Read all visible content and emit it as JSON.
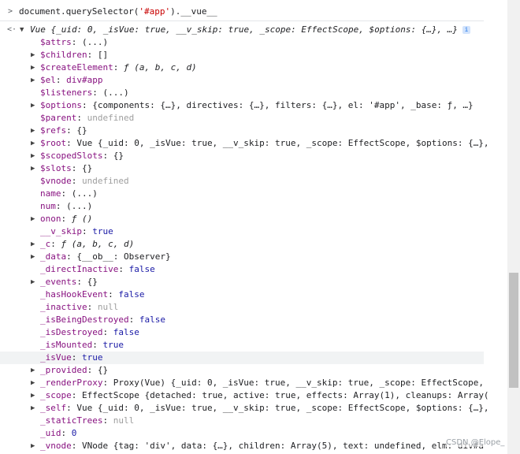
{
  "console": {
    "input": {
      "prefix": "document.querySelector(",
      "arg": "'#app'",
      "suffix": ").__vue__"
    },
    "result_summary": "Vue {_uid: 0, _isVue: true, __v_skip: true, _scope: EffectScope, $options: {…}, …}",
    "info_badge": "i",
    "properties": [
      {
        "key": "$attrs",
        "sep": ": ",
        "value": "(...)",
        "expandable": false,
        "dim": false
      },
      {
        "key": "$children",
        "sep": ": ",
        "value": "[]",
        "expandable": true,
        "dim": false
      },
      {
        "key": "$createElement",
        "sep": ": ",
        "value": "ƒ (a, b, c, d)",
        "expandable": true,
        "dim": false
      },
      {
        "key": "$el",
        "sep": ": ",
        "value": "div#app",
        "expandable": true,
        "dim": false
      },
      {
        "key": "$listeners",
        "sep": ": ",
        "value": "(...)",
        "expandable": false,
        "dim": false
      },
      {
        "key": "$options",
        "sep": ": ",
        "value": "{components: {…}, directives: {…}, filters: {…}, el: '#app', _base: ƒ, …}",
        "expandable": true,
        "dim": false
      },
      {
        "key": "$parent",
        "sep": ": ",
        "value": "undefined",
        "expandable": false,
        "dim": false
      },
      {
        "key": "$refs",
        "sep": ": ",
        "value": "{}",
        "expandable": true,
        "dim": false
      },
      {
        "key": "$root",
        "sep": ": ",
        "value": "Vue {_uid: 0, _isVue: true, __v_skip: true, _scope: EffectScope, $options: {…},",
        "expandable": true,
        "dim": false
      },
      {
        "key": "$scopedSlots",
        "sep": ": ",
        "value": "{}",
        "expandable": true,
        "dim": false
      },
      {
        "key": "$slots",
        "sep": ": ",
        "value": "{}",
        "expandable": true,
        "dim": false
      },
      {
        "key": "$vnode",
        "sep": ": ",
        "value": "undefined",
        "expandable": false,
        "dim": false
      },
      {
        "key": "name",
        "sep": ": ",
        "value": "(...)",
        "expandable": false,
        "dim": false
      },
      {
        "key": "num",
        "sep": ": ",
        "value": "(...)",
        "expandable": false,
        "dim": false
      },
      {
        "key": "onon",
        "sep": ": ",
        "value": "ƒ ()",
        "expandable": true,
        "dim": false
      },
      {
        "key": "__v_skip",
        "sep": ": ",
        "value": "true",
        "expandable": false,
        "dim": false
      },
      {
        "key": "_c",
        "sep": ": ",
        "value": "ƒ (a, b, c, d)",
        "expandable": true,
        "dim": false
      },
      {
        "key": "_data",
        "sep": ": ",
        "value": "{__ob__: Observer}",
        "expandable": true,
        "dim": false
      },
      {
        "key": "_directInactive",
        "sep": ": ",
        "value": "false",
        "expandable": false,
        "dim": false
      },
      {
        "key": "_events",
        "sep": ": ",
        "value": "{}",
        "expandable": true,
        "dim": false
      },
      {
        "key": "_hasHookEvent",
        "sep": ": ",
        "value": "false",
        "expandable": false,
        "dim": false
      },
      {
        "key": "_inactive",
        "sep": ": ",
        "value": "null",
        "expandable": false,
        "dim": false
      },
      {
        "key": "_isBeingDestroyed",
        "sep": ": ",
        "value": "false",
        "expandable": false,
        "dim": false
      },
      {
        "key": "_isDestroyed",
        "sep": ": ",
        "value": "false",
        "expandable": false,
        "dim": false
      },
      {
        "key": "_isMounted",
        "sep": ": ",
        "value": "true",
        "expandable": false,
        "dim": false
      },
      {
        "key": "_isVue",
        "sep": ": ",
        "value": "true",
        "expandable": false,
        "dim": false,
        "highlight": true
      },
      {
        "key": "_provided",
        "sep": ": ",
        "value": "{}",
        "expandable": true,
        "dim": false
      },
      {
        "key": "_renderProxy",
        "sep": ": ",
        "value": "Proxy(Vue) {_uid: 0, _isVue: true, __v_skip: true, _scope: EffectScope,",
        "expandable": true,
        "dim": false
      },
      {
        "key": "_scope",
        "sep": ": ",
        "value": "EffectScope {detached: true, active: true, effects: Array(1), cleanups: Array(",
        "expandable": true,
        "dim": false
      },
      {
        "key": "_self",
        "sep": ": ",
        "value": "Vue {_uid: 0, _isVue: true, __v_skip: true, _scope: EffectScope, $options: {…},",
        "expandable": true,
        "dim": false
      },
      {
        "key": "_staticTrees",
        "sep": ": ",
        "value": "null",
        "expandable": false,
        "dim": false
      },
      {
        "key": "_uid",
        "sep": ": ",
        "value": "0",
        "expandable": false,
        "dim": false
      },
      {
        "key": "_vnode",
        "sep": ": ",
        "value": "VNode {tag: 'div', data: {…}, children: Array(5), text: undefined, elm: div#a",
        "expandable": true,
        "dim": false
      }
    ]
  },
  "watermark": "CSDN @Elope_",
  "colors": {
    "key": "#881280",
    "string": "#c80000",
    "keyword": "#1a1aa6",
    "dim": "#9e9e9e"
  }
}
